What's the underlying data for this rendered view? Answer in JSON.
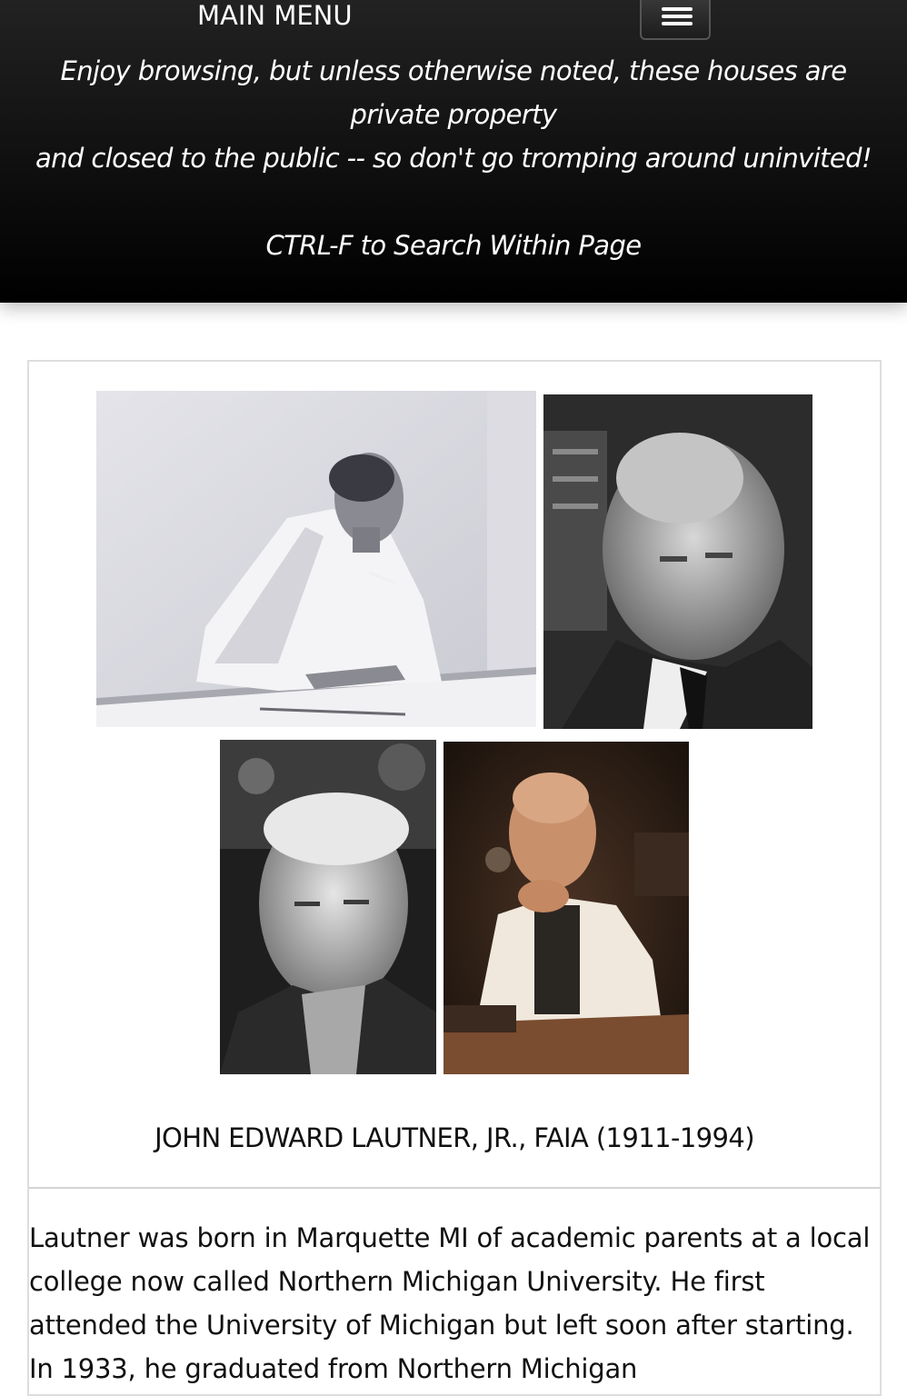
{
  "header": {
    "menu_label": "MAIN MENU",
    "notice_line1": "Enjoy browsing, but unless otherwise noted, these houses are",
    "notice_line2": "private property",
    "notice_line3": "and closed to the public -- so don't go tromping around uninvited!",
    "search_hint": "CTRL-F to Search Within Page",
    "menu_icon": "hamburger-icon"
  },
  "photos": [
    {
      "name": "lautner-drafting-photo",
      "icon": "photo"
    },
    {
      "name": "lautner-portrait-photo",
      "icon": "photo"
    },
    {
      "name": "lautner-outdoor-portrait-photo",
      "icon": "photo"
    },
    {
      "name": "lautner-color-portrait-photo",
      "icon": "photo"
    }
  ],
  "biography": {
    "caption": "JOHN EDWARD LAUTNER, JR., FAIA (1911-1994)",
    "text": "Lautner was born in Marquette MI of academic parents at a local college now called Northern Michigan University. He first attended the University of Michigan but left soon after starting. In 1933, he graduated from Northern Michigan"
  },
  "colors": {
    "header_bg": "#111111",
    "header_text": "#ffffff",
    "box_border": "#dddddd",
    "body_text": "#111111"
  }
}
